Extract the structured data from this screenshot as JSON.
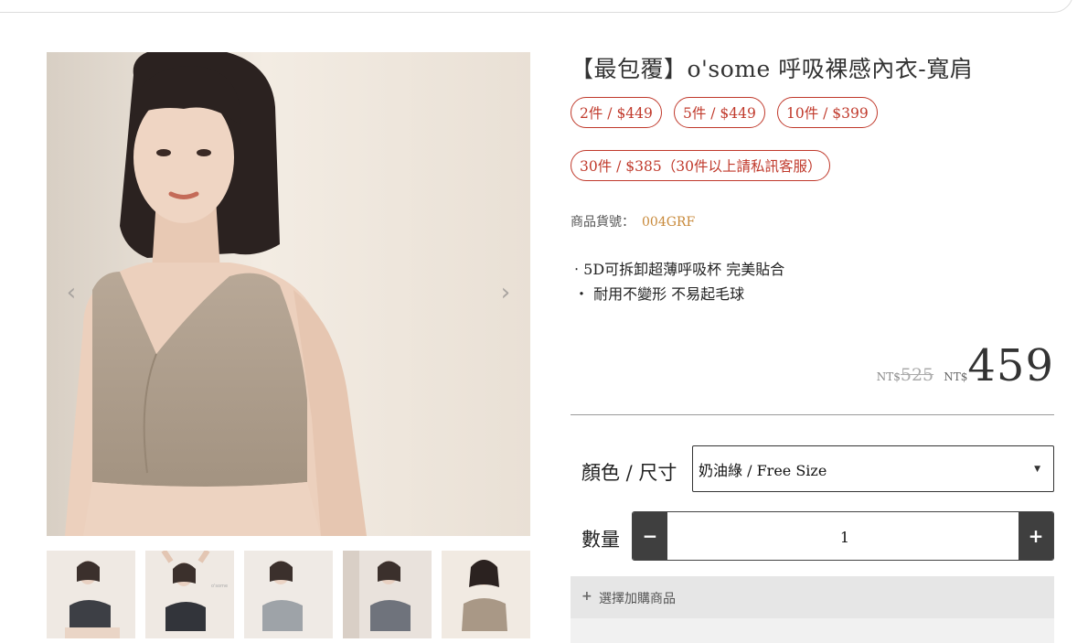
{
  "product": {
    "title": "【最包覆】o'some 呼吸裸感內衣-寬肩",
    "offers": [
      {
        "label": "2件 / $449"
      },
      {
        "label": "5件 / $449"
      },
      {
        "label": "10件 / $399"
      },
      {
        "label": "30件 / $385（30件以上請私訊客服）"
      }
    ],
    "sku_label": "商品貨號：",
    "sku_value": "004GRF",
    "features": [
      "‧ 5D可拆卸超薄呼吸杯 完美貼合",
      "‧ 耐用不變形 不易起毛球"
    ],
    "price": {
      "currency": "NT$",
      "original": "525",
      "current": "459"
    }
  },
  "options": {
    "variant_label": "顏色 / 尺寸",
    "variant_value": "奶油綠 / Free Size",
    "quantity_label": "數量",
    "quantity_value": "1",
    "minus_symbol": "−",
    "plus_symbol": "+"
  },
  "addon": {
    "plus": "+",
    "label": "選擇加購商品"
  },
  "gallery": {
    "prev_icon": "chevron-left-icon",
    "next_icon": "chevron-right-icon",
    "thumbnail_count": 5,
    "selected_thumbnail": 5
  },
  "colors": {
    "offer_accent": "#c0392b",
    "sku_accent": "#c8893a",
    "button_dark": "#3f3f3f",
    "addon_bg": "#e6e6e6"
  }
}
